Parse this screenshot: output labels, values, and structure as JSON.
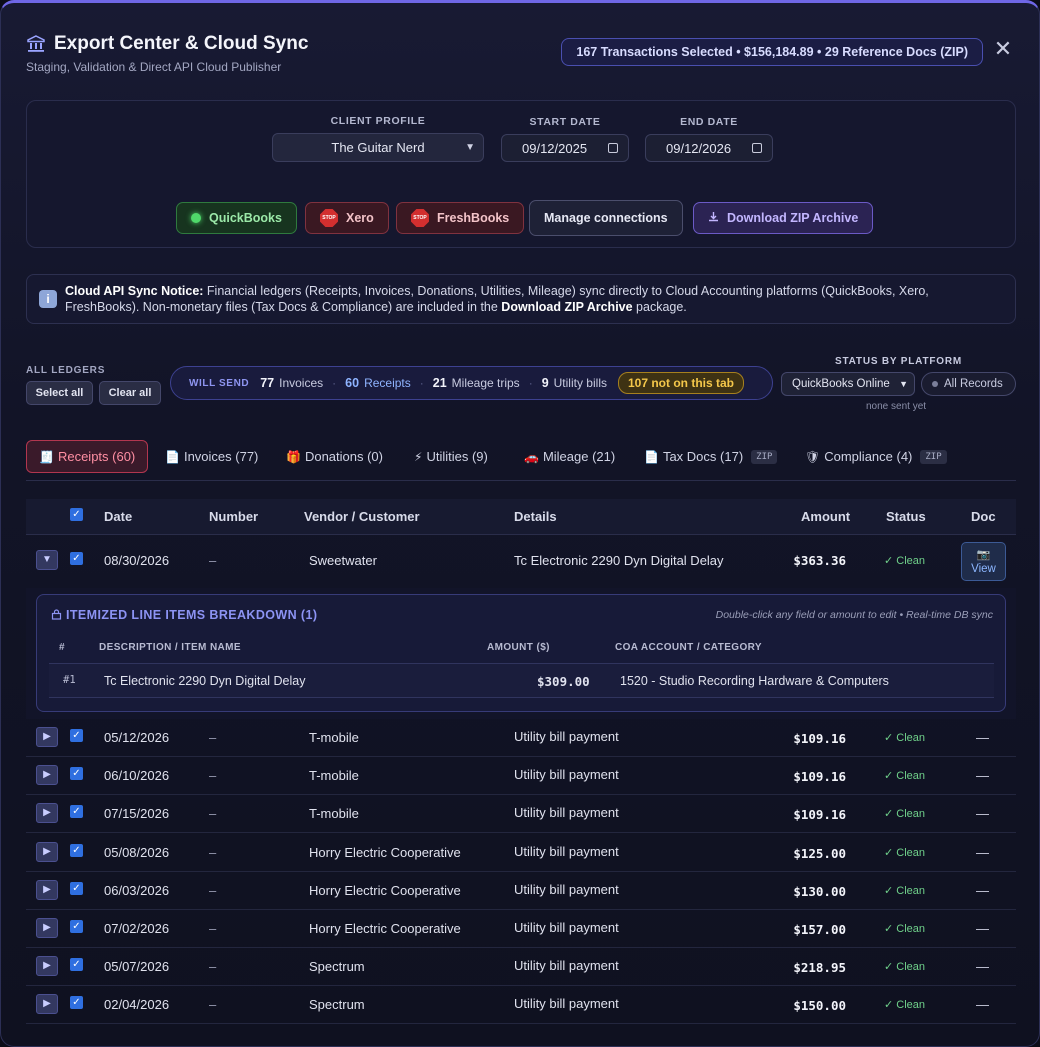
{
  "header": {
    "title": "Export Center & Cloud Sync",
    "subtitle": "Staging, Validation & Direct API Cloud Publisher",
    "selection_summary": "167 Transactions Selected • $156,184.89 • 29 Reference Docs (ZIP)",
    "close_glyph": "✕"
  },
  "filters": {
    "client_profile_label": "CLIENT PROFILE",
    "client_profile_value": "The Guitar Nerd",
    "start_date_label": "START DATE",
    "start_date_value": "09/12/2025",
    "end_date_label": "END DATE",
    "end_date_value": "09/12/2026"
  },
  "connections": {
    "quickbooks": "QuickBooks",
    "xero": "Xero",
    "freshbooks": "FreshBooks",
    "stop_text": "STOP",
    "manage": "Manage connections",
    "zip": "Download ZIP Archive"
  },
  "notice": {
    "lead": "Cloud API Sync Notice:",
    "body1": " Financial ledgers (Receipts, Invoices, Donations, Utilities, Mileage) sync directly to Cloud Accounting platforms (QuickBooks, Xero, FreshBooks). Non-monetary files (Tax Docs & Compliance) are included in the ",
    "zip_bold": "Download ZIP Archive",
    "body2": " package."
  },
  "ledgers": {
    "all_label": "ALL LEDGERS",
    "select_all": "Select all",
    "clear_all": "Clear all",
    "will_send_label": "WILL SEND",
    "invoices_count": "77",
    "invoices_label": "Invoices",
    "receipts_count": "60",
    "receipts_label": "Receipts",
    "mileage_count": "21",
    "mileage_label": "Mileage trips",
    "utility_count": "9",
    "utility_label": "Utility bills",
    "not_on_tab": "107 not on this tab",
    "status_by_platform_label": "STATUS BY PLATFORM",
    "platform_value": "QuickBooks Online",
    "all_records": "All Records",
    "none_sent": "none sent yet"
  },
  "tabs": [
    {
      "icon": "🧾",
      "label": "Receipts (60)"
    },
    {
      "icon": "📄",
      "label": "Invoices (77)"
    },
    {
      "icon": "🎁",
      "label": "Donations (0)"
    },
    {
      "icon": "⚡",
      "label": "Utilities (9)"
    },
    {
      "icon": "🚗",
      "label": "Mileage (21)"
    },
    {
      "icon": "📄",
      "label": "Tax Docs (17)",
      "tag": "ZIP"
    },
    {
      "icon": "🛡",
      "label": "Compliance (4)",
      "tag": "ZIP"
    }
  ],
  "table": {
    "headers": {
      "date": "Date",
      "number": "Number",
      "vendor": "Vendor / Customer",
      "details": "Details",
      "amount": "Amount",
      "status": "Status",
      "doc": "Doc"
    },
    "expanded_row": {
      "date": "08/30/2026",
      "number": "–",
      "vendor": "Sweetwater",
      "details": "Tc Electronic 2290 Dyn Digital Delay",
      "amount": "$363.36",
      "status": "✓ Clean",
      "doc_icon": "📷",
      "doc_label": "View"
    },
    "breakdown": {
      "title": "ITEMIZED LINE ITEMS BREAKDOWN (1)",
      "hint": "Double-click any field or amount to edit • Real-time DB sync",
      "col_num": "#",
      "col_desc": "DESCRIPTION / ITEM NAME",
      "col_amount": "AMOUNT ($)",
      "col_coa": "COA ACCOUNT / CATEGORY",
      "line_num": "#1",
      "line_desc": "Tc Electronic 2290 Dyn Digital Delay",
      "line_amount": "$309.00",
      "line_coa": "1520 - Studio Recording Hardware & Computers"
    },
    "rows": [
      {
        "date": "05/12/2026",
        "number": "–",
        "vendor": "T-mobile",
        "details": "Utility bill payment",
        "amount": "$109.16",
        "status": "✓ Clean",
        "doc": "—"
      },
      {
        "date": "06/10/2026",
        "number": "–",
        "vendor": "T-mobile",
        "details": "Utility bill payment",
        "amount": "$109.16",
        "status": "✓ Clean",
        "doc": "—"
      },
      {
        "date": "07/15/2026",
        "number": "–",
        "vendor": "T-mobile",
        "details": "Utility bill payment",
        "amount": "$109.16",
        "status": "✓ Clean",
        "doc": "—"
      },
      {
        "date": "05/08/2026",
        "number": "–",
        "vendor": "Horry Electric Cooperative",
        "details": "Utility bill payment",
        "amount": "$125.00",
        "status": "✓ Clean",
        "doc": "—"
      },
      {
        "date": "06/03/2026",
        "number": "–",
        "vendor": "Horry Electric Cooperative",
        "details": "Utility bill payment",
        "amount": "$130.00",
        "status": "✓ Clean",
        "doc": "—"
      },
      {
        "date": "07/02/2026",
        "number": "–",
        "vendor": "Horry Electric Cooperative",
        "details": "Utility bill payment",
        "amount": "$157.00",
        "status": "✓ Clean",
        "doc": "—"
      },
      {
        "date": "05/07/2026",
        "number": "–",
        "vendor": "Spectrum",
        "details": "Utility bill payment",
        "amount": "$218.95",
        "status": "✓ Clean",
        "doc": "—"
      },
      {
        "date": "02/04/2026",
        "number": "–",
        "vendor": "Spectrum",
        "details": "Utility bill payment",
        "amount": "$150.00",
        "status": "✓ Clean",
        "doc": "—"
      }
    ]
  },
  "colors": {
    "accent": "#6f67e6",
    "clean": "#6fd08a",
    "active_tab": "#ff8fa3",
    "warning": "#f4c74a"
  }
}
